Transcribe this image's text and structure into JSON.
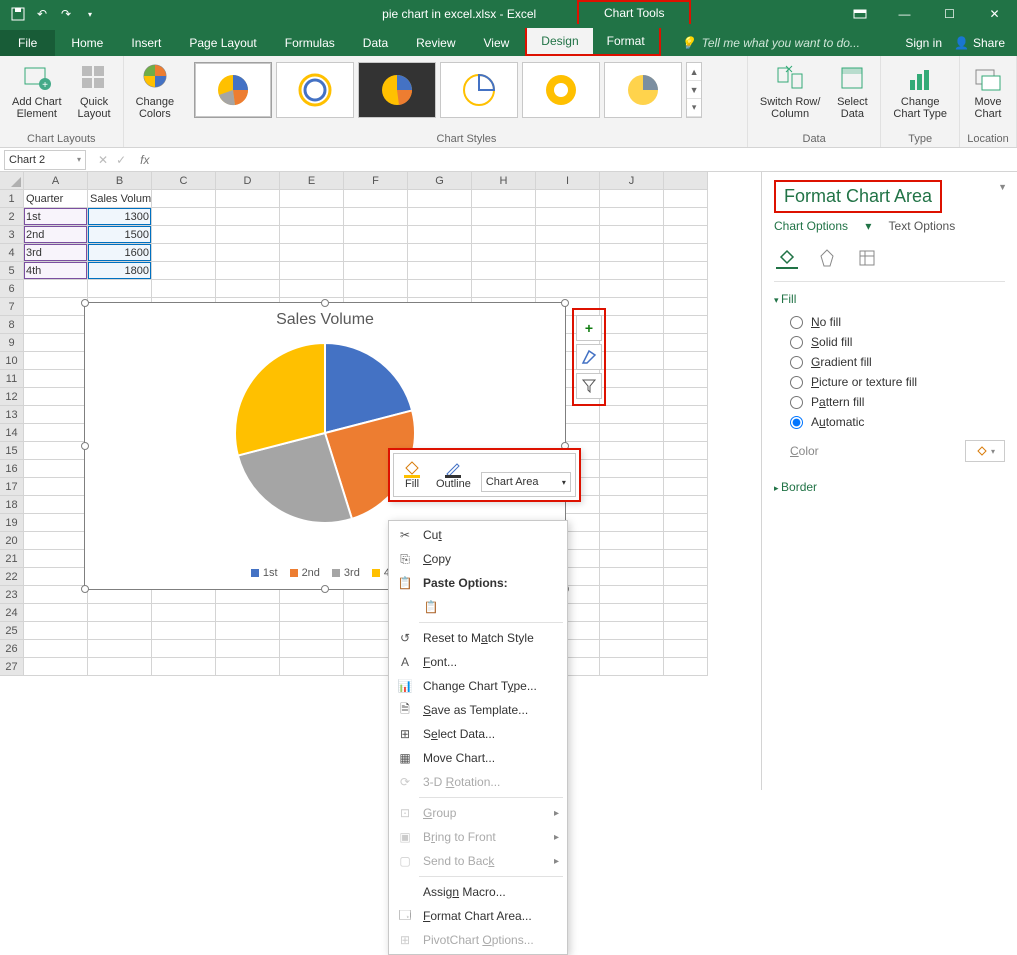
{
  "app": {
    "title": "pie chart in excel.xlsx - Excel",
    "chart_tools": "Chart Tools"
  },
  "tabs": {
    "file": "File",
    "home": "Home",
    "insert": "Insert",
    "page_layout": "Page Layout",
    "formulas": "Formulas",
    "data": "Data",
    "review": "Review",
    "view": "View",
    "design": "Design",
    "format": "Format",
    "tell_me": "Tell me what you want to do...",
    "sign_in": "Sign in",
    "share": "Share"
  },
  "ribbon": {
    "add_chart_element": "Add Chart\nElement",
    "quick_layout": "Quick\nLayout",
    "change_colors": "Change\nColors",
    "switch_row_col": "Switch Row/\nColumn",
    "select_data": "Select\nData",
    "change_chart_type": "Change\nChart Type",
    "move_chart": "Move\nChart",
    "g_chart_layouts": "Chart Layouts",
    "g_chart_styles": "Chart Styles",
    "g_data": "Data",
    "g_type": "Type",
    "g_location": "Location"
  },
  "namebox": "Chart 2",
  "grid": {
    "cols": [
      "A",
      "B",
      "C",
      "D",
      "E",
      "F",
      "G",
      "H",
      "I",
      "J"
    ],
    "rows": 27,
    "headers": [
      "Quarter",
      "Sales Volume"
    ],
    "data": [
      [
        "1st",
        "1300"
      ],
      [
        "2nd",
        "1500"
      ],
      [
        "3rd",
        "1600"
      ],
      [
        "4th",
        "1800"
      ]
    ]
  },
  "chart_data": {
    "type": "pie",
    "title": "Sales Volume",
    "categories": [
      "1st",
      "2nd",
      "3rd",
      "4th"
    ],
    "values": [
      1300,
      1500,
      1600,
      1800
    ],
    "colors": [
      "#4472C4",
      "#ED7D31",
      "#A5A5A5",
      "#FFC000"
    ]
  },
  "mini_toolbar": {
    "fill": "Fill",
    "outline": "Outline",
    "selector": "Chart Area"
  },
  "context_menu": {
    "cut": "Cut",
    "copy": "Copy",
    "paste_options": "Paste Options:",
    "reset": "Reset to Match Style",
    "font": "Font...",
    "change_type": "Change Chart Type...",
    "save_template": "Save as Template...",
    "select_data": "Select Data...",
    "move_chart": "Move Chart...",
    "rotation": "3-D Rotation...",
    "group": "Group",
    "bring_front": "Bring to Front",
    "send_back": "Send to Back",
    "assign_macro": "Assign Macro...",
    "format_area": "Format Chart Area...",
    "pivot_options": "PivotChart Options..."
  },
  "pane": {
    "title": "Format Chart Area",
    "chart_options": "Chart Options",
    "text_options": "Text Options",
    "fill": "Fill",
    "no_fill": "No fill",
    "solid_fill": "Solid fill",
    "gradient_fill": "Gradient fill",
    "picture_fill": "Picture or texture fill",
    "pattern_fill": "Pattern fill",
    "automatic": "Automatic",
    "color": "Color",
    "border": "Border"
  }
}
